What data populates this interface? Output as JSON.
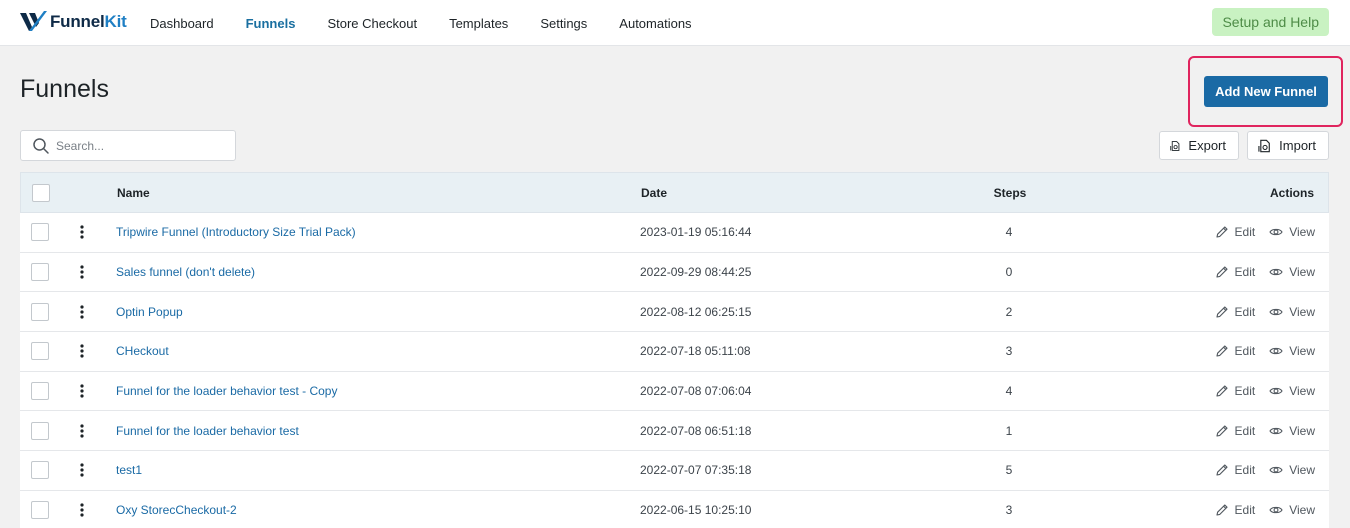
{
  "brand": {
    "name_prefix": "Funnel",
    "name_suffix": "Kit",
    "colors": {
      "primary": "#1a6aa5",
      "highlight": "#e0245e",
      "help_bg": "#c9f2c2"
    }
  },
  "nav": {
    "items": [
      {
        "label": "Dashboard"
      },
      {
        "label": "Funnels",
        "active": true
      },
      {
        "label": "Store Checkout"
      },
      {
        "label": "Templates"
      },
      {
        "label": "Settings"
      },
      {
        "label": "Automations"
      }
    ],
    "help_label": "Setup and Help"
  },
  "page": {
    "title": "Funnels",
    "add_button": "Add New Funnel"
  },
  "toolbar": {
    "search_placeholder": "Search...",
    "export_label": "Export",
    "import_label": "Import",
    "icons": {
      "search": "search-icon",
      "export": "export-icon",
      "import": "import-icon"
    }
  },
  "table": {
    "headers": {
      "name": "Name",
      "date": "Date",
      "steps": "Steps",
      "actions": "Actions"
    },
    "action_labels": {
      "edit": "Edit",
      "view": "View"
    },
    "rows": [
      {
        "name": "Tripwire Funnel (Introductory Size Trial Pack)",
        "date": "2023-01-19 05:16:44",
        "steps": "4"
      },
      {
        "name": "Sales funnel (don't delete)",
        "date": "2022-09-29 08:44:25",
        "steps": "0"
      },
      {
        "name": "Optin Popup",
        "date": "2022-08-12 06:25:15",
        "steps": "2"
      },
      {
        "name": "CHeckout",
        "date": "2022-07-18 05:11:08",
        "steps": "3"
      },
      {
        "name": "Funnel for the loader behavior test - Copy",
        "date": "2022-07-08 07:06:04",
        "steps": "4"
      },
      {
        "name": "Funnel for the loader behavior test",
        "date": "2022-07-08 06:51:18",
        "steps": "1"
      },
      {
        "name": "test1",
        "date": "2022-07-07 07:35:18",
        "steps": "5"
      },
      {
        "name": "Oxy StorecCheckout-2",
        "date": "2022-06-15 10:25:10",
        "steps": "3"
      }
    ]
  }
}
